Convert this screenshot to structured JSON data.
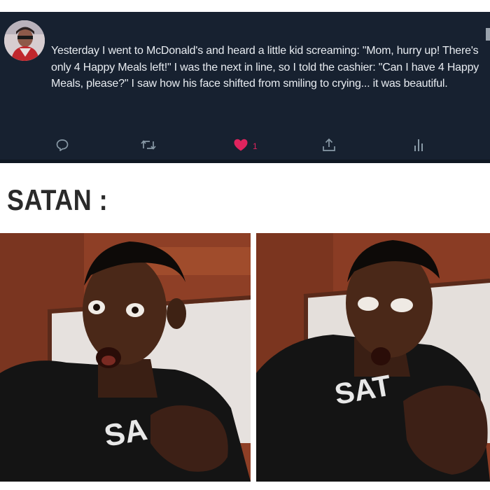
{
  "tweet": {
    "text": "Yesterday I went to McDonald's and heard a little kid screaming: \"Mom, hurry up! There's only 4 Happy Meals left!\" I was the next in line, so I told the cashier: \"Can I have 4 Happy Meals, please?\" I saw how his face shifted from smiling to crying... it was beautiful.",
    "actions": {
      "reply_icon": "reply-icon",
      "retweet_icon": "retweet-icon",
      "like_icon": "heart-icon",
      "like_count": "1",
      "share_icon": "share-icon",
      "analytics_icon": "analytics-icon"
    },
    "colors": {
      "background": "#172130",
      "text": "#e8ecf1",
      "icon": "#8899a6",
      "like": "#e0245e"
    }
  },
  "caption": "SATAN :",
  "photos": {
    "left": {
      "shirt_text": "SA"
    },
    "right": {
      "shirt_text": "SAT"
    }
  }
}
